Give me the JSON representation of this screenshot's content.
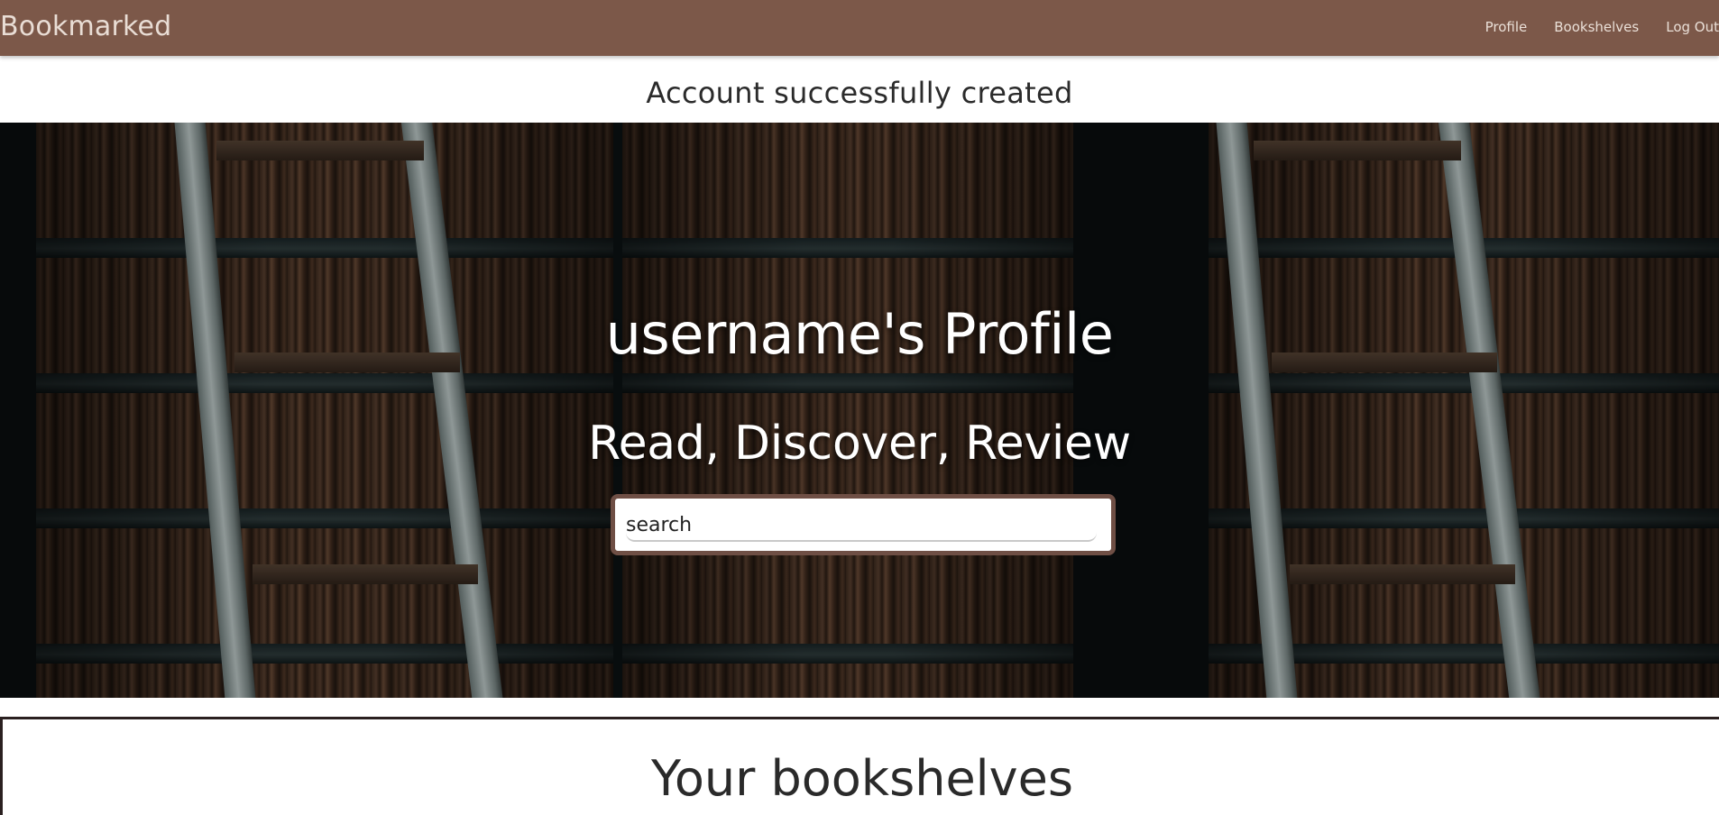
{
  "navbar": {
    "brand": "Bookmarked",
    "links": [
      "Profile",
      "Bookshelves",
      "Log Out"
    ]
  },
  "flash": {
    "message": "Account successfully created"
  },
  "hero": {
    "title": "username's Profile",
    "subtitle": "Read, Discover, Review",
    "search": {
      "placeholder": "search",
      "value": ""
    }
  },
  "shelves": {
    "title": "Your bookshelves"
  },
  "colors": {
    "navbar": "#7c5849",
    "search_border": "#6f4f45"
  }
}
